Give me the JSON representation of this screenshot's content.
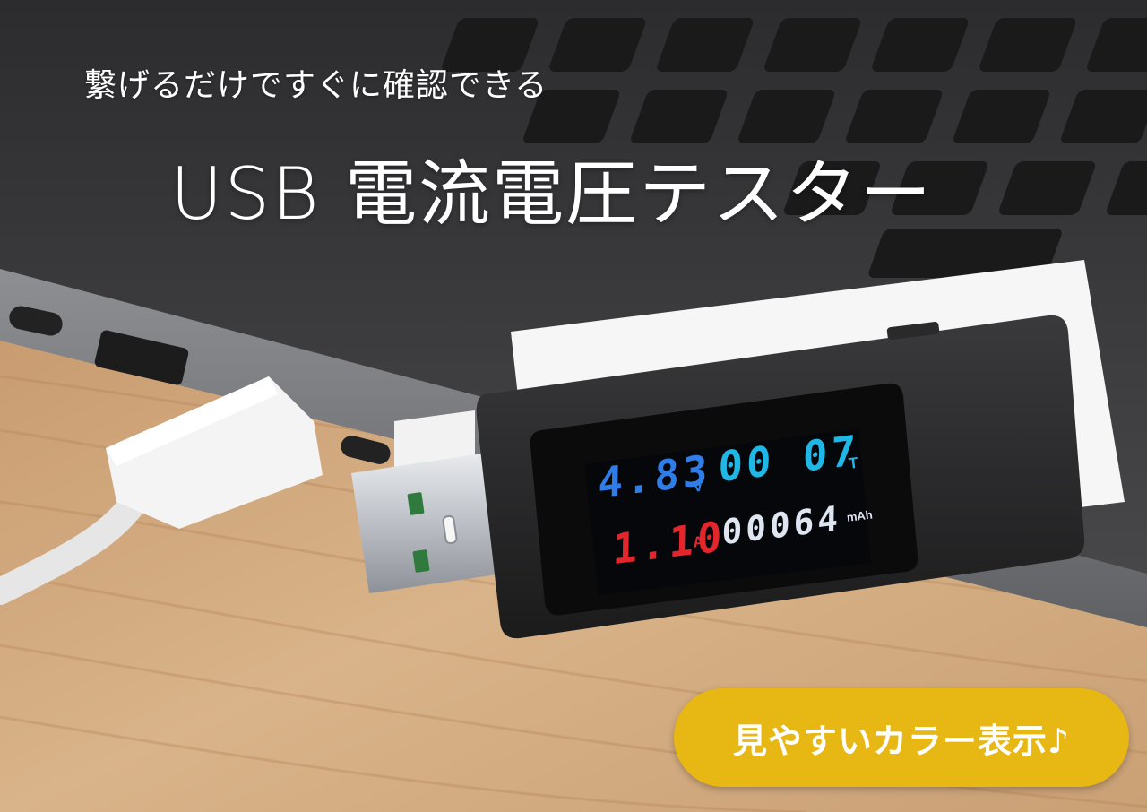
{
  "headline": {
    "subtitle": "繋げるだけですぐに確認できる",
    "title": "USB 電流電圧テスター"
  },
  "device_display": {
    "voltage": "4.83",
    "voltage_unit": "V",
    "time": "00 07",
    "time_unit": "T",
    "current": "1.10",
    "current_unit": "A",
    "capacity": "00064",
    "capacity_unit": "mAh"
  },
  "badge": {
    "label": "見やすいカラー表示♪"
  },
  "colors": {
    "voltage": "#2f7de8",
    "time": "#1fb7e6",
    "current": "#e2262c",
    "capacity": "#dfe6f2",
    "badge": "#e7b714"
  }
}
